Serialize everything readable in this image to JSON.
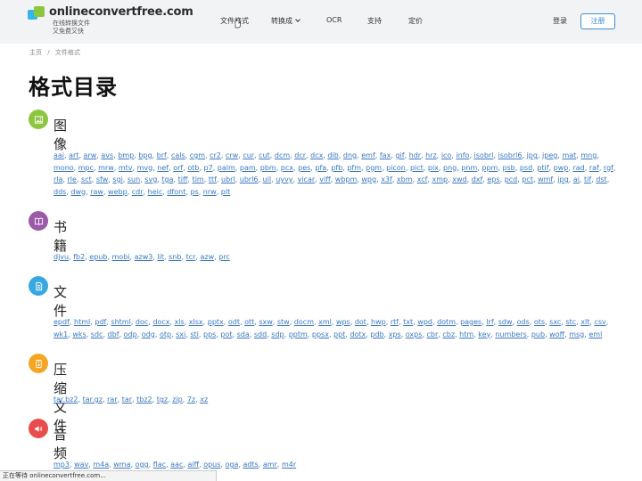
{
  "header": {
    "site_name": "onlineconvertfree.com",
    "tagline_1": "在线转换文件",
    "tagline_2": "又免费又快",
    "nav": [
      "文件格式",
      "转换成",
      "OCR",
      "支持",
      "定价"
    ],
    "login": "登录",
    "register": "注册"
  },
  "breadcrumb": [
    "主页",
    "/",
    "文件格式"
  ],
  "page_title": "格式目录",
  "categories": [
    {
      "title": "图像",
      "icon": "image-icon",
      "color": "#8cc63f",
      "formats": [
        "aai",
        "art",
        "arw",
        "avs",
        "bmp",
        "bpg",
        "brf",
        "cals",
        "cgm",
        "cr2",
        "crw",
        "cur",
        "cut",
        "dcm",
        "dcr",
        "dcx",
        "dib",
        "dng",
        "emf",
        "fax",
        "gif",
        "hdr",
        "hrz",
        "ico",
        "info",
        "isobrl",
        "isobrl6",
        "jpg",
        "jpeg",
        "mat",
        "mng",
        "mono",
        "mpc",
        "mrw",
        "mtv",
        "mvg",
        "nef",
        "orf",
        "otb",
        "p7",
        "palm",
        "pam",
        "pbm",
        "pcx",
        "pes",
        "pfa",
        "pfb",
        "pfm",
        "pgm",
        "picon",
        "pict",
        "pix",
        "png",
        "pnm",
        "ppm",
        "psb",
        "psd",
        "ptif",
        "pwp",
        "rad",
        "raf",
        "rgf",
        "rla",
        "rle",
        "sct",
        "sfw",
        "sgi",
        "sun",
        "svg",
        "tga",
        "tiff",
        "tim",
        "ttf",
        "ubrl",
        "ubrl6",
        "uil",
        "uyvy",
        "vicar",
        "viff",
        "wbpm",
        "wpg",
        "x3f",
        "xbm",
        "xcf",
        "xmp",
        "xwd",
        "dxf",
        "eps",
        "pcd",
        "pct",
        "wmf",
        "jpg",
        "ai",
        "tif",
        "dst",
        "dds",
        "dwg",
        "raw",
        "webp",
        "cdr",
        "heic",
        "dfont",
        "ps",
        "nrw",
        "plt"
      ]
    },
    {
      "title": "书籍",
      "icon": "book-icon",
      "color": "#9b59a8",
      "formats": [
        "djvu",
        "fb2",
        "epub",
        "mobi",
        "azw3",
        "lit",
        "snb",
        "tcr",
        "azw",
        "prc"
      ]
    },
    {
      "title": "文件",
      "icon": "document-icon",
      "color": "#3aa8e0",
      "formats": [
        "epdf",
        "html",
        "pdf",
        "shtml",
        "doc",
        "docx",
        "xls",
        "xlsx",
        "pptx",
        "odt",
        "ott",
        "sxw",
        "stw",
        "docm",
        "xml",
        "wps",
        "dot",
        "hwp",
        "rtf",
        "txt",
        "wpd",
        "dotm",
        "pages",
        "lrf",
        "sdw",
        "ods",
        "ots",
        "sxc",
        "stc",
        "xlt",
        "csv",
        "wk1",
        "wks",
        "sdc",
        "dbf",
        "odp",
        "odg",
        "otp",
        "sxi",
        "sti",
        "pps",
        "pot",
        "sda",
        "sdd",
        "sdp",
        "pptm",
        "ppsx",
        "ppt",
        "dotx",
        "pdb",
        "xps",
        "oxps",
        "cbr",
        "cbz",
        "htm",
        "key",
        "numbers",
        "pub",
        "woff",
        "msg",
        "eml"
      ]
    },
    {
      "title": "压缩文件",
      "icon": "archive-icon",
      "color": "#f5a623",
      "formats": [
        "tar.bz2",
        "tar.gz",
        "rar",
        "tar",
        "tbz2",
        "tgz",
        "zip",
        "7z",
        "xz"
      ]
    },
    {
      "title": "音频",
      "icon": "speaker-icon",
      "color": "#e84c4c",
      "formats": [
        "mp3",
        "wav",
        "m4a",
        "wma",
        "ogg",
        "flac",
        "aac",
        "aiff",
        "opus",
        "oga",
        "adts",
        "amr",
        "m4r"
      ]
    }
  ],
  "status_bar": "正在等待 onlineconvertfree.com..."
}
